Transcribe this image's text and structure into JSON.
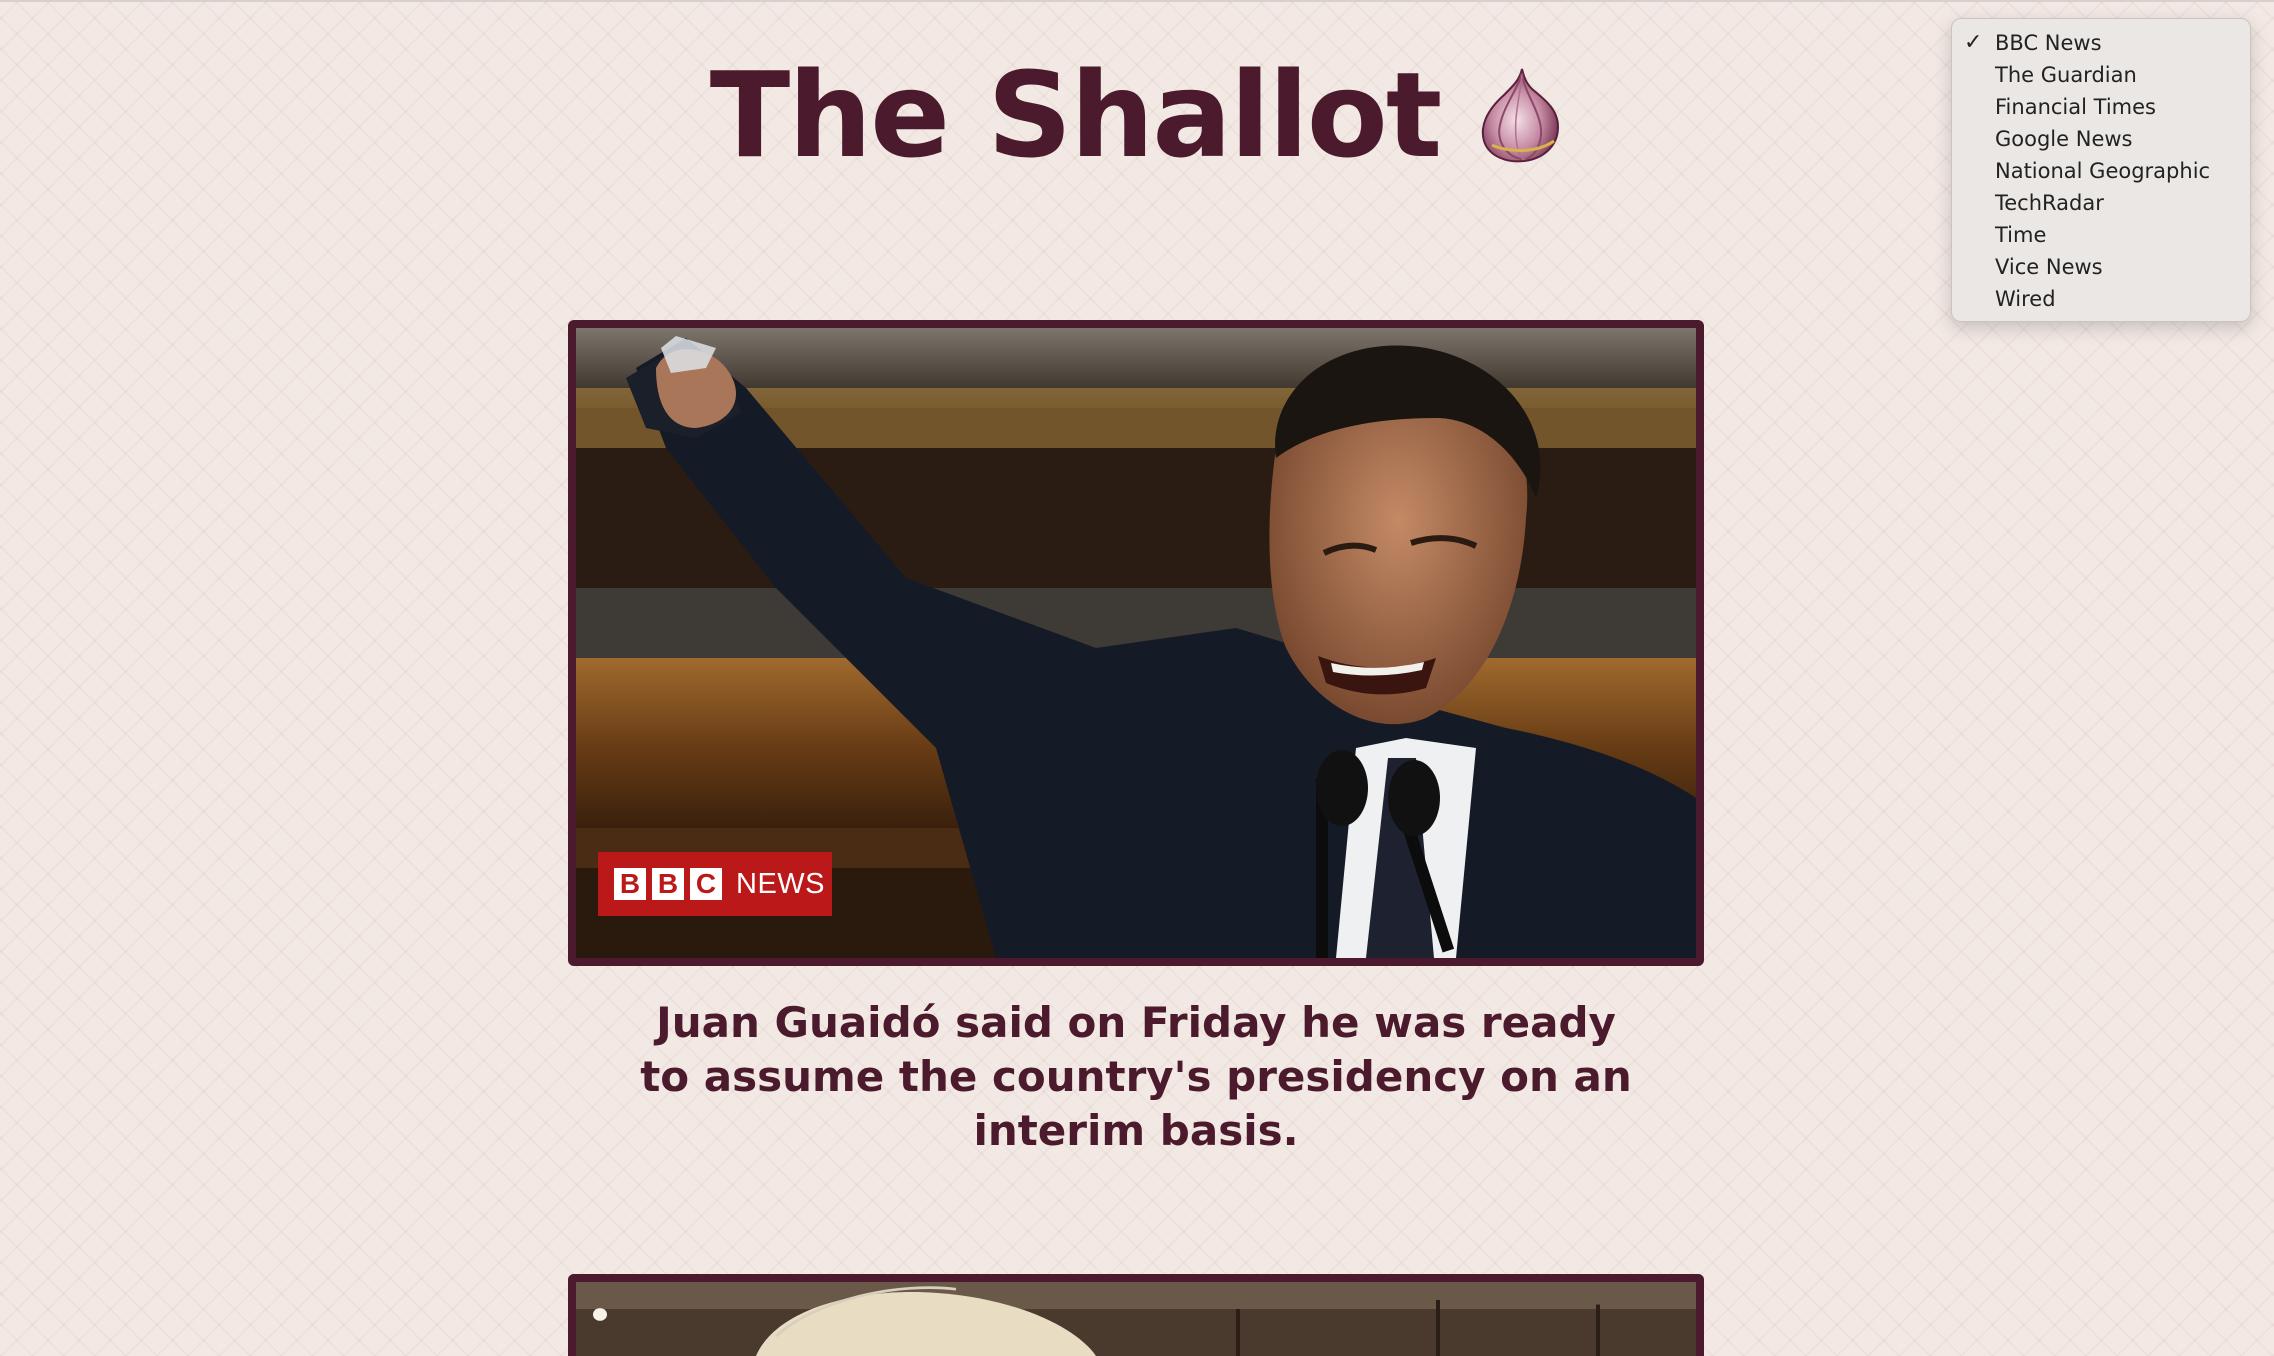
{
  "site": {
    "title": "The Shallot",
    "logo_icon": "onion-icon"
  },
  "articles": [
    {
      "image": "Man in dark suit raising a clenched fist while speaking at microphones",
      "source_logo": {
        "letters": [
          "B",
          "B",
          "C"
        ],
        "word": "NEWS"
      },
      "headline": "Juan Guaidó said on Friday he was ready to assume the country's presidency on an interim basis."
    },
    {
      "image": "Photo of a person with grey hair, partially visible",
      "headline": ""
    }
  ],
  "source_menu": {
    "selected": "BBC News",
    "options": [
      "BBC News",
      "The Guardian",
      "Financial Times",
      "Google News",
      "National Geographic",
      "TechRadar",
      "Time",
      "Vice News",
      "Wired"
    ]
  },
  "colors": {
    "brand": "#4b1a2c",
    "background": "#f3e9e4",
    "bbc_red": "#bb1919"
  }
}
